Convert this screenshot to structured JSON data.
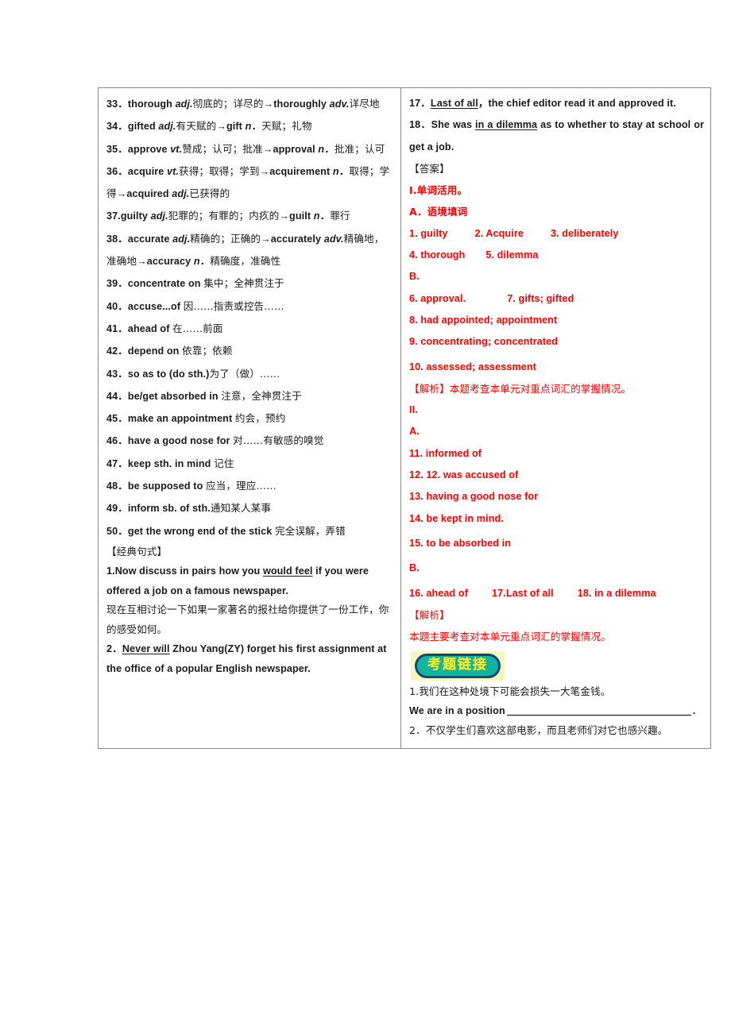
{
  "document": {
    "layout": "two-column-table",
    "accent_red": "#FE0000",
    "badge": {
      "label": "考题链接",
      "fill_color": "#12B4A0",
      "border_color": "#16447A",
      "text_color": "#F7EE2E",
      "background_color": "#F6F6C0"
    }
  },
  "left_column": {
    "vocab_items": [
      {
        "num": "33．",
        "en": "thorough ",
        "pos": "adj.",
        "cn": "彻底的；详尽的",
        "arrow": "→",
        "en2": "thoroughly ",
        "pos2": "adv.",
        "cn2": "详尽地"
      },
      {
        "num": "34．",
        "en": "gifted ",
        "pos": "adj.",
        "cn": "有天赋的",
        "arrow": "→",
        "en2": "gift ",
        "pos2": "n．",
        "cn2": "天赋；礼物"
      },
      {
        "num": "35．",
        "en": "approve ",
        "pos": "vt.",
        "cn": "赞成；认可；批准",
        "arrow": "→",
        "en2": "approval ",
        "pos2": "n．",
        "cn2": "批准；认可"
      },
      {
        "num": "36．",
        "en": "acquire ",
        "pos": "vt.",
        "cn": "获得；取得；学到",
        "arrow": "→",
        "en2": "acquirement ",
        "pos2": "n．",
        "cn2": "取得；学得",
        "arrow3": "→",
        "en3": "acquired ",
        "pos3": "adj.",
        "cn3": "已获得的"
      },
      {
        "num": "37.",
        "en": "guilty ",
        "pos": "adj.",
        "cn": "犯罪的；有罪的；内疚的",
        "arrow": "→",
        "en2": "guilt ",
        "pos2": "n．",
        "cn2": "罪行"
      },
      {
        "num": "38．",
        "en": "accurate ",
        "pos": "adj.",
        "cn": "精确的；正确的",
        "arrow": "→",
        "en2": "accurately ",
        "pos2": "adv.",
        "cn2": "精确地，准确地",
        "arrow3": "→",
        "en3": "accuracy ",
        "pos3": "n．",
        "cn3": "精确度，准确性"
      },
      {
        "num": "39．",
        "en": "concentrate on ",
        "cn": "集中；全神贯注于"
      },
      {
        "num": "40．",
        "en": "accuse...of ",
        "cn": "因……指责或控告……"
      },
      {
        "num": "41．",
        "en": "ahead of ",
        "cn": "在……前面"
      },
      {
        "num": "42．",
        "en": "depend on ",
        "cn": "依靠；依赖"
      },
      {
        "num": "43．",
        "en": "so as to (do sth.)",
        "cn": "为了（做）……"
      },
      {
        "num": "44．",
        "en": "be/get absorbed in ",
        "cn": "注意，全神贯注于"
      },
      {
        "num": "45．",
        "en": "make an appointment ",
        "cn": "约会，预约"
      },
      {
        "num": "46．",
        "en": "have a good nose for ",
        "cn": "对……有敏感的嗅觉"
      },
      {
        "num": "47．",
        "en": "keep sth. in mind ",
        "cn": "记住"
      },
      {
        "num": "48．",
        "en": "be supposed to ",
        "cn": "应当，理应……"
      },
      {
        "num": "49．",
        "en": "inform sb. of sth.",
        "cn": "通知某人某事"
      },
      {
        "num": "50．",
        "en": "get the wrong end of the stick ",
        "cn": "完全误解，弄错"
      }
    ],
    "classic_sentences_heading": "【经典句式】",
    "sentence1_num": "1.",
    "sentence1_pre": "Now discuss in pairs how you ",
    "sentence1_underline": "would feel",
    "sentence1_post": " if you were offered a job on a famous newspaper.",
    "sentence1_cn": "现在互相讨论一下如果一家著名的报社给你提供了一份工作，你的感受如何。",
    "sentence2_num": "2．",
    "sentence2_underline": "Never will",
    "sentence2_post": " Zhou Yang(ZY) forget his first assignment at the office of a popular English newspaper."
  },
  "right_column": {
    "item17_num": "17．",
    "item17_underline": "Last of all",
    "item17_post": "，the chief editor read it and approved it.",
    "item18_num": "18．",
    "item18_pre": "She was ",
    "item18_underline": "in a dilemma",
    "item18_post": " as to whether to stay at school or get a job.",
    "answer_heading": "【答案】",
    "section_I": "I.单词活用。",
    "section_I_A": "A．语境填词",
    "answers_A_row1": [
      {
        "label": "1. guilty"
      },
      {
        "label": "2. Acquire"
      },
      {
        "label": "3. deliberately"
      }
    ],
    "answers_A_row2": [
      {
        "label": "4. thorough"
      },
      {
        "label": "5. dilemma"
      }
    ],
    "section_I_B": "B.",
    "answers_B_row1": [
      {
        "label": "6. approval."
      },
      {
        "label": "7. gifts; gifted"
      }
    ],
    "answers_B_rest": [
      "8. had appointed; appointment",
      "9. concentrating; concentrated",
      "10. assessed; assessment"
    ],
    "analysis1": "【解析】本题考查本单元对重点词汇的掌握情况。",
    "section_II": "II.",
    "section_II_A": "A.",
    "answers_II_A": [
      "11. informed of",
      "12. 12. was accused of",
      "13. having a good nose for",
      "14. be kept in mind.",
      "15. to be absorbed in"
    ],
    "section_II_B": "B.",
    "answers_II_B_row": [
      {
        "label": "16. ahead of"
      },
      {
        "label": "17.Last of all"
      },
      {
        "label": "18. in a dilemma"
      }
    ],
    "analysis2_heading": "【解析】",
    "analysis2_body": "本题主要考查对本单元重点词汇的掌握情况。",
    "badge_label": "考题链接",
    "linked_q1": "1.我们在这种处境下可能会损失一大笔金钱。",
    "linked_q1_en": "We are in a position",
    "linked_q1_end": ".",
    "linked_q2": "2．不仅学生们喜欢这部电影，而且老师们对它也感兴趣。"
  }
}
